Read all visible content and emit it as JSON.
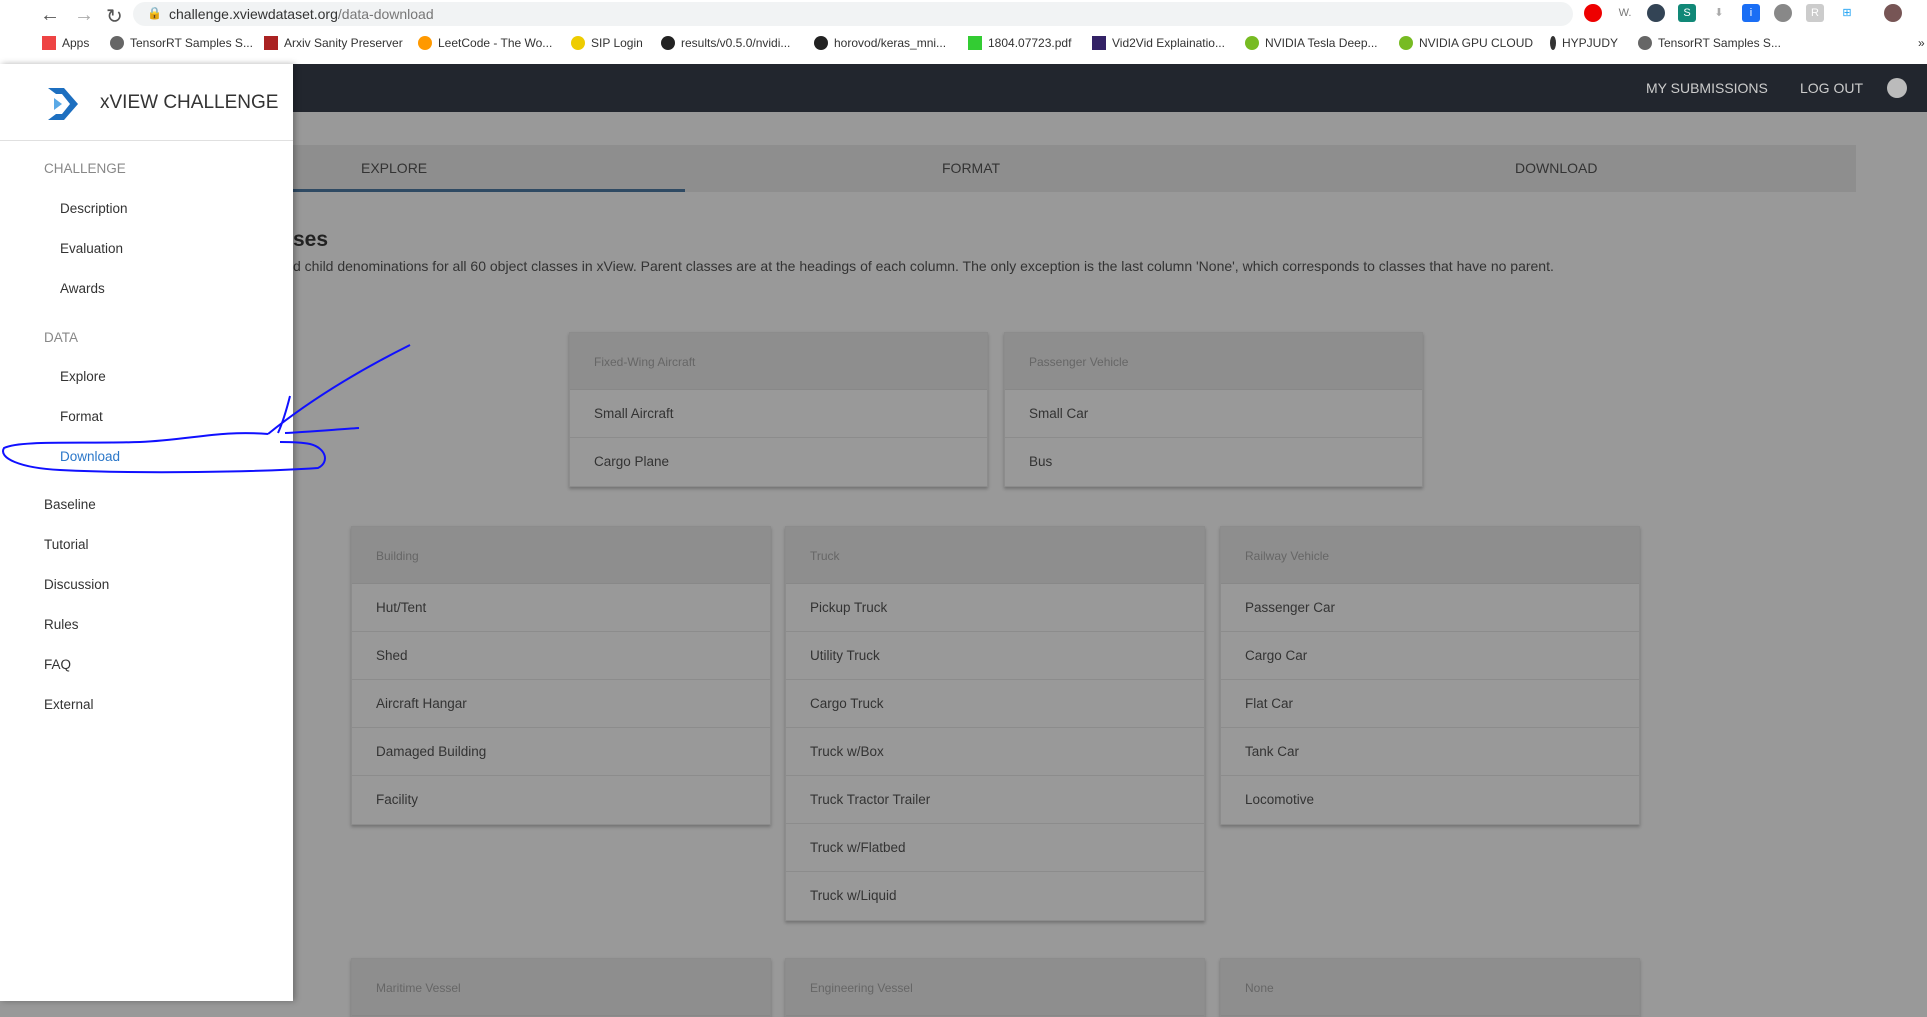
{
  "browser": {
    "url_host": "challenge.xviewdataset.org",
    "url_path": "/data-download",
    "bookmarks": [
      "Apps",
      "TensorRT Samples S...",
      "Arxiv Sanity Preserver",
      "LeetCode - The Wo...",
      "SIP Login",
      "results/v0.5.0/nvidi...",
      "horovod/keras_mni...",
      "1804.07723.pdf",
      "Vid2Vid Explainatio...",
      "NVIDIA Tesla Deep...",
      "NVIDIA GPU CLOUD",
      "HYPJUDY",
      "TensorRT Samples S..."
    ],
    "more": "»"
  },
  "header": {
    "my_submissions": "MY SUBMISSIONS",
    "log_out": "LOG OUT"
  },
  "sidebar": {
    "brand": "xVIEW CHALLENGE",
    "sections": [
      {
        "label": "CHALLENGE",
        "items": [
          "Description",
          "Evaluation",
          "Awards"
        ]
      },
      {
        "label": "DATA",
        "items": [
          "Explore",
          "Format",
          "Download"
        ]
      }
    ],
    "top_items": [
      "Baseline",
      "Tutorial",
      "Discussion",
      "Rules",
      "FAQ",
      "External"
    ],
    "active": "Download"
  },
  "tabs": [
    "EXPLORE",
    "FORMAT",
    "DOWNLOAD"
  ],
  "active_tab": "EXPLORE",
  "main": {
    "title_partial": "ses",
    "description_partial": "d child denominations for all 60 object classes in xView. Parent classes are at the headings of each column. The only exception is the last column 'None', which corresponds to classes that have no parent.",
    "cards": [
      {
        "parent": "Fixed-Wing Aircraft",
        "children": [
          "Small Aircraft",
          "Cargo Plane"
        ]
      },
      {
        "parent": "Passenger Vehicle",
        "children": [
          "Small Car",
          "Bus"
        ]
      },
      {
        "parent": "Building",
        "children": [
          "Hut/Tent",
          "Shed",
          "Aircraft Hangar",
          "Damaged Building",
          "Facility"
        ]
      },
      {
        "parent": "Truck",
        "children": [
          "Pickup Truck",
          "Utility Truck",
          "Cargo Truck",
          "Truck w/Box",
          "Truck Tractor Trailer",
          "Truck w/Flatbed",
          "Truck w/Liquid"
        ]
      },
      {
        "parent": "Railway Vehicle",
        "children": [
          "Passenger Car",
          "Cargo Car",
          "Flat Car",
          "Tank Car",
          "Locomotive"
        ]
      },
      {
        "parent": "Maritime Vessel",
        "children": []
      },
      {
        "parent": "Engineering Vessel",
        "children": []
      },
      {
        "parent": "None",
        "children": []
      }
    ]
  },
  "colors": {
    "annotation": "#1010ff",
    "active_link": "#2b77c9",
    "header_bg": "#22262e"
  }
}
